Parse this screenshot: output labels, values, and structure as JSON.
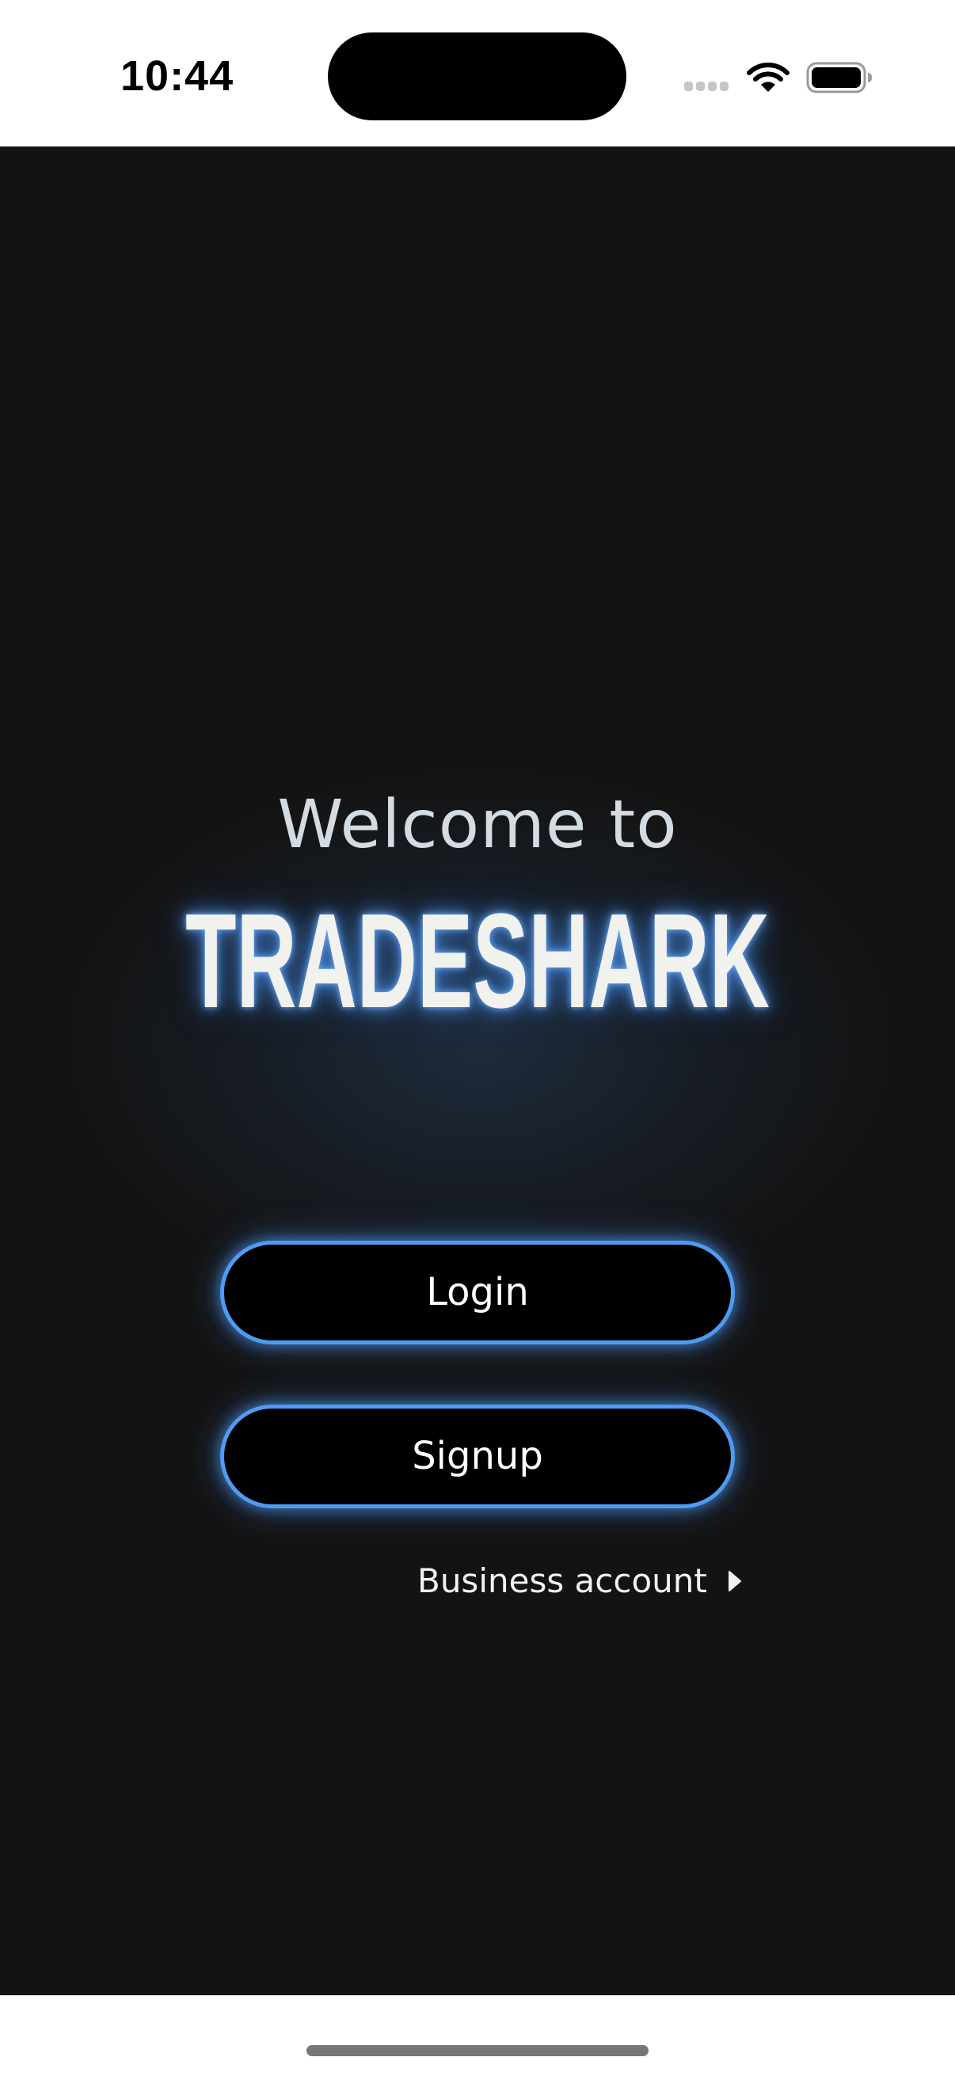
{
  "status_bar": {
    "time": "10:44",
    "icons": [
      "cellular-signal-icon",
      "wifi-icon",
      "battery-icon"
    ]
  },
  "welcome": {
    "greeting": "Welcome to",
    "brand": "TRADESHARK"
  },
  "actions": {
    "login_label": "Login",
    "signup_label": "Signup",
    "business_label": "Business account",
    "business_icon": "caret-right-icon"
  },
  "colors": {
    "background": "#131313",
    "accent": "#4f9bf2",
    "button_fill": "#000000",
    "text_light": "#f1f1ed"
  }
}
